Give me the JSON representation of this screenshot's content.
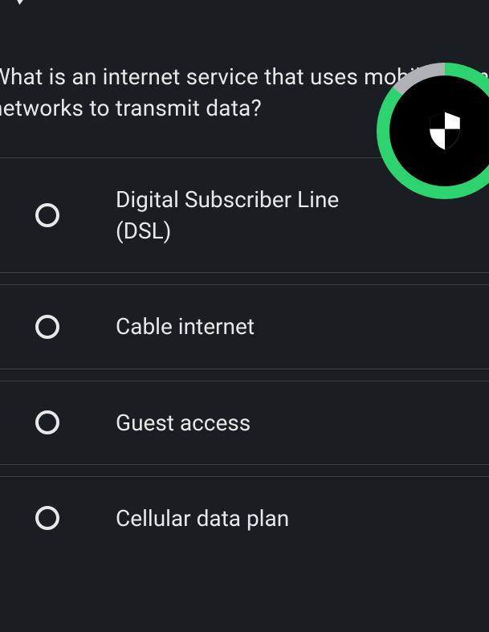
{
  "question": {
    "line1": "What is an internet service that uses mobile phone",
    "line2": "networks to transmit data?"
  },
  "options": [
    {
      "label": "Digital Subscriber Line (DSL)"
    },
    {
      "label": "Cable internet"
    },
    {
      "label": "Guest access"
    },
    {
      "label": "Cellular data plan"
    }
  ],
  "progress": {
    "percent": 86,
    "ring_color": "#2dd36f",
    "remaining_color": "#aeb2b7",
    "icon": "shield-icon"
  }
}
